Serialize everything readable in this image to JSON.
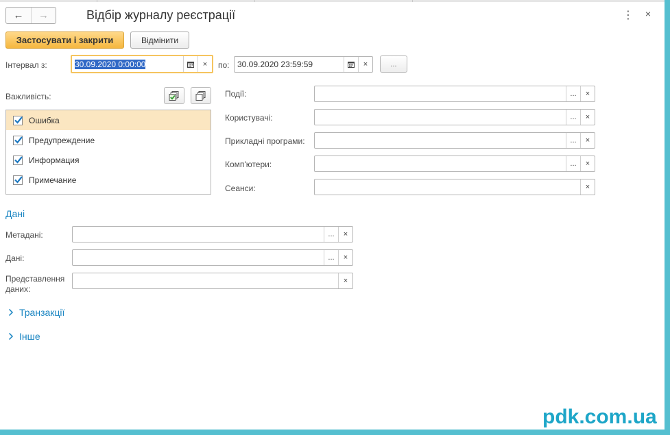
{
  "window": {
    "title": "Відбір журналу реєстрації",
    "back_icon": "←",
    "forward_icon": "→",
    "menu_icon": "⋮",
    "close_icon": "×"
  },
  "toolbar": {
    "apply_label": "Застосувати і закрити",
    "cancel_label": "Відмінити"
  },
  "interval": {
    "from_label": "Інтервал з:",
    "from_value": "30.09.2020  0:00:00",
    "to_label": "по:",
    "to_value": "30.09.2020 23:59:59",
    "period_button": "..."
  },
  "importance": {
    "label": "Важливість:",
    "items": [
      {
        "label": "Ошибка",
        "checked": true
      },
      {
        "label": "Предупреждение",
        "checked": true
      },
      {
        "label": "Информация",
        "checked": true
      },
      {
        "label": "Примечание",
        "checked": true
      }
    ]
  },
  "filters": {
    "events_label": "Події:",
    "users_label": "Користувачі:",
    "apps_label": "Прикладні програми:",
    "computers_label": "Комп'ютери:",
    "sessions_label": "Сеанси:"
  },
  "data_section": {
    "title": "Дані",
    "metadata_label": "Метадані:",
    "data_label": "Дані:",
    "presentation_label": "Представлення даних:"
  },
  "groups": {
    "transactions": "Транзакції",
    "other": "Інше",
    "chevron_icon": "›"
  },
  "field_buttons": {
    "select": "...",
    "clear": "×"
  },
  "watermark": "pdk.com.ua",
  "colors": {
    "accent": "#f5b73f",
    "link": "#1a85c2",
    "selection": "#fbe6c1",
    "frame": "#55bfd0"
  }
}
